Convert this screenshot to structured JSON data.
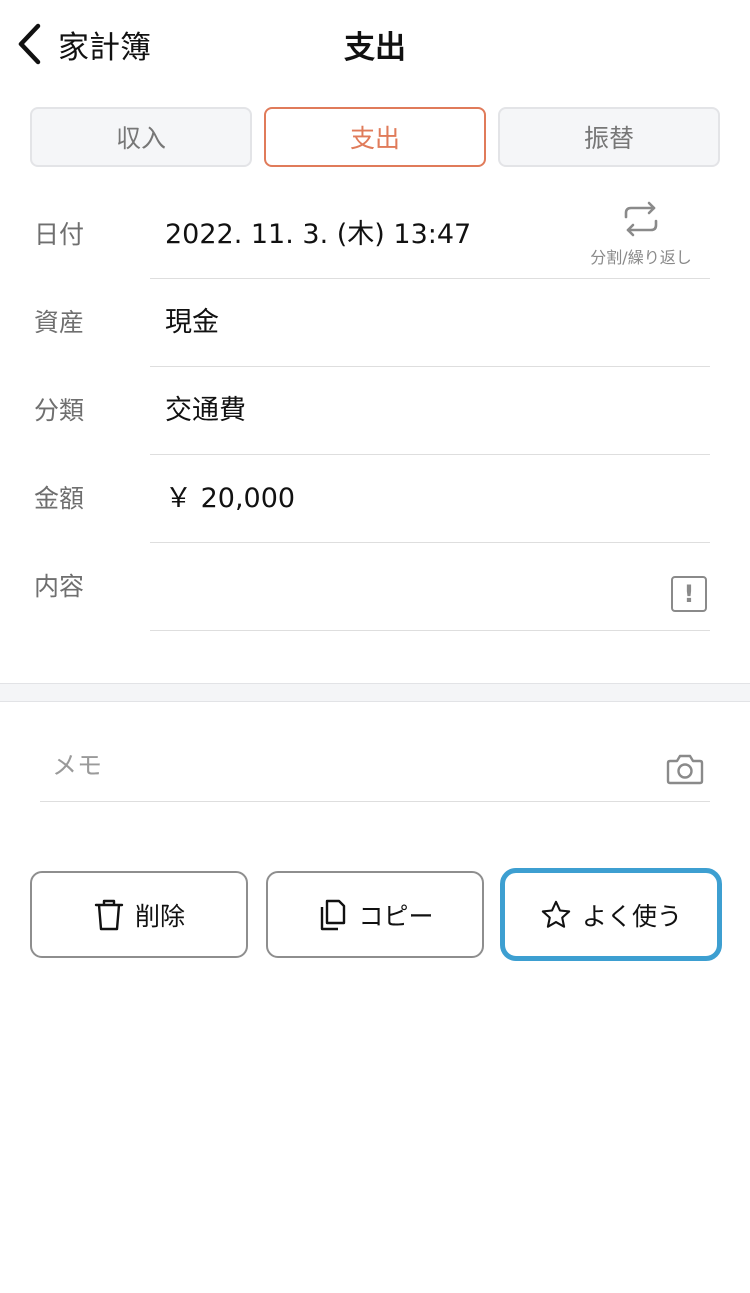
{
  "nav": {
    "back_label": "家計簿",
    "title": "支出"
  },
  "tabs": [
    {
      "label": "収入",
      "selected": false
    },
    {
      "label": "支出",
      "selected": true
    },
    {
      "label": "振替",
      "selected": false
    }
  ],
  "form": {
    "date": {
      "label": "日付",
      "value": "2022. 11. 3. (木)   13:47"
    },
    "asset": {
      "label": "資産",
      "value": "現金"
    },
    "category": {
      "label": "分類",
      "value": "交通費"
    },
    "amount": {
      "label": "金額",
      "value": "￥ 20,000"
    },
    "content": {
      "label": "内容",
      "value": ""
    }
  },
  "repeat": {
    "label": "分割/繰り返し"
  },
  "info_icon": {
    "glyph": "!"
  },
  "memo": {
    "placeholder": "メモ"
  },
  "actions": {
    "delete_label": "削除",
    "copy_label": "コピー",
    "favorite_label": "よく使う"
  },
  "colors": {
    "accent_orange": "#e07b5a",
    "highlight_blue": "#3d9fd1",
    "label_gray": "#6f6f6f"
  },
  "icons": {
    "back": "chevron-left-icon",
    "repeat": "repeat-icon",
    "info": "exclamation-icon",
    "camera": "camera-icon",
    "delete": "trash-icon",
    "copy": "copy-icon",
    "favorite": "star-icon"
  }
}
